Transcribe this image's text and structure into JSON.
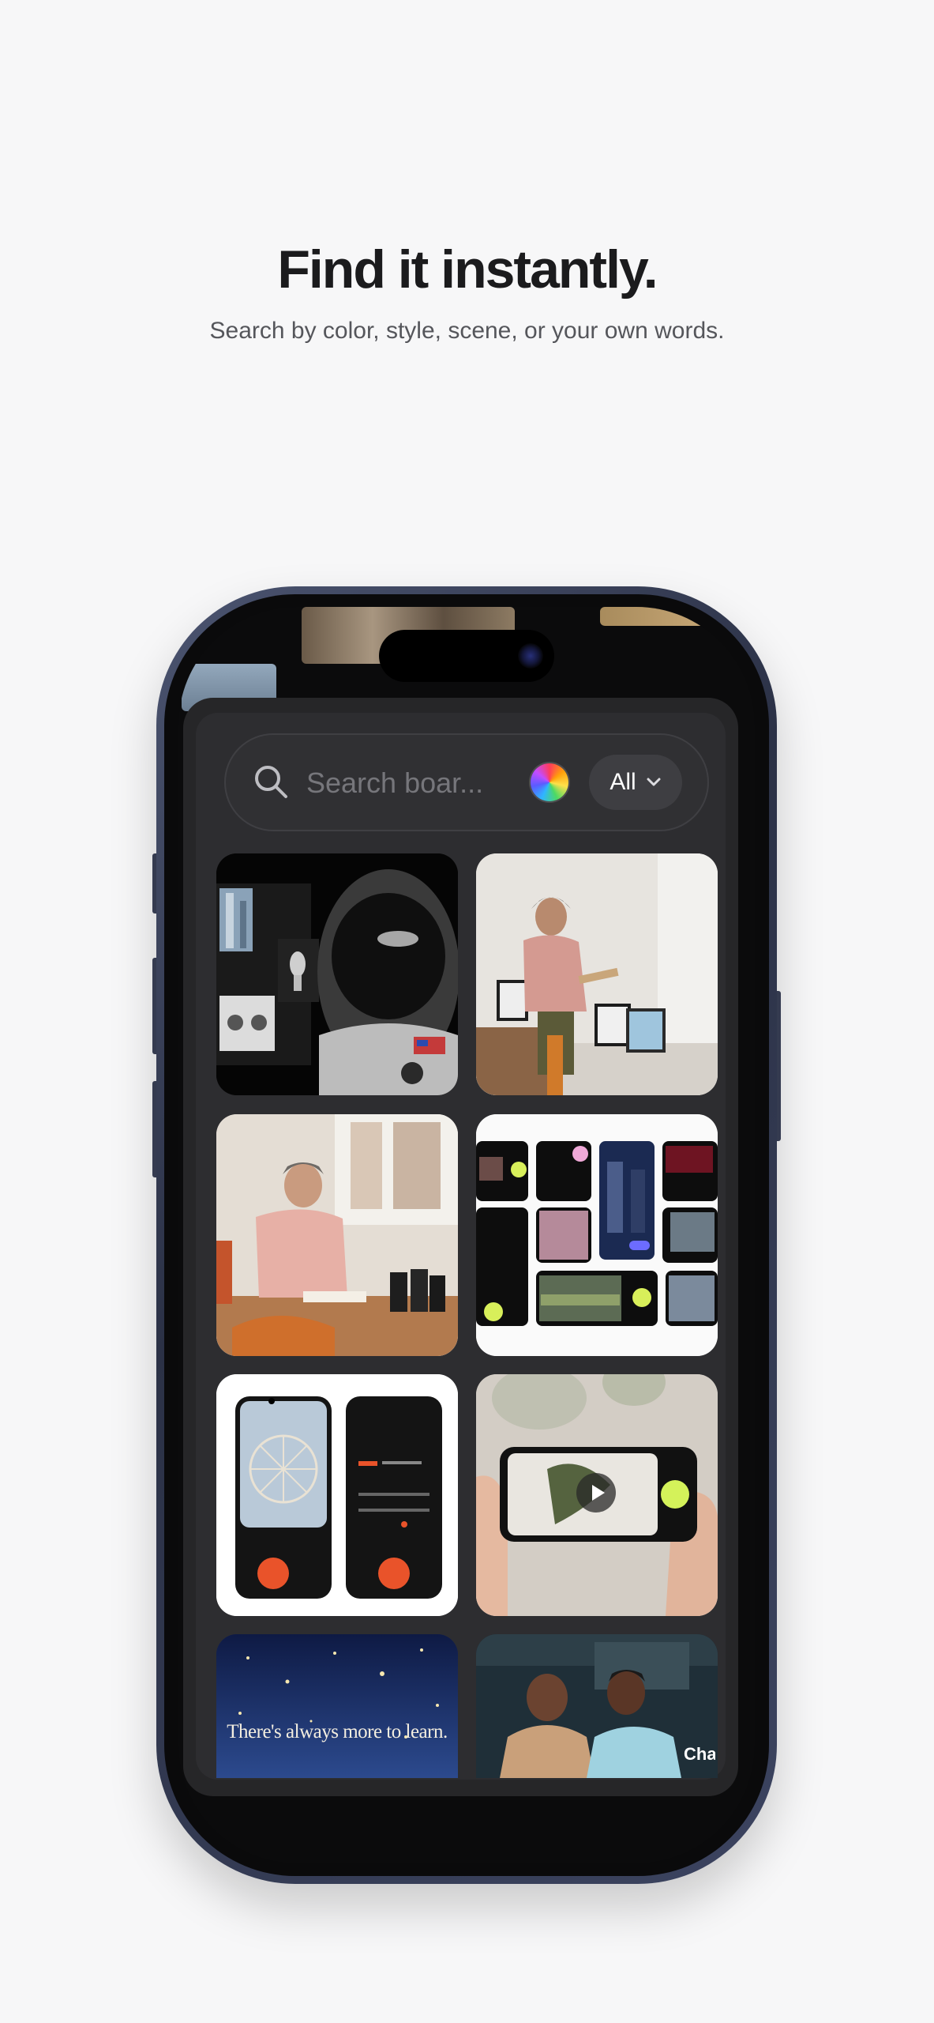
{
  "hero": {
    "title": "Find it instantly.",
    "subtitle": "Search by color, style, scene, or your own words."
  },
  "search": {
    "placeholder": "Search boar...",
    "icon": "search-icon",
    "color_picker_icon": "color-wheel-icon",
    "filter": {
      "label": "All",
      "icon": "chevron-down-icon"
    }
  },
  "grid": {
    "items": [
      {
        "name": "astronaut-moodboard"
      },
      {
        "name": "man-with-notebook-studio"
      },
      {
        "name": "man-at-desk-binoculars"
      },
      {
        "name": "camera-app-screens-collage"
      },
      {
        "name": "ferris-wheel-phone-screens"
      },
      {
        "name": "hands-holding-phone-video"
      },
      {
        "name": "starry-sky-poster",
        "text": "There's always more to learn."
      },
      {
        "name": "people-in-car",
        "text": "Chat"
      }
    ]
  },
  "colors": {
    "background": "#f7f7f8",
    "panel": "#2d2d30",
    "accent_orange": "#e9532a",
    "accent_lime": "#d4f25a"
  }
}
